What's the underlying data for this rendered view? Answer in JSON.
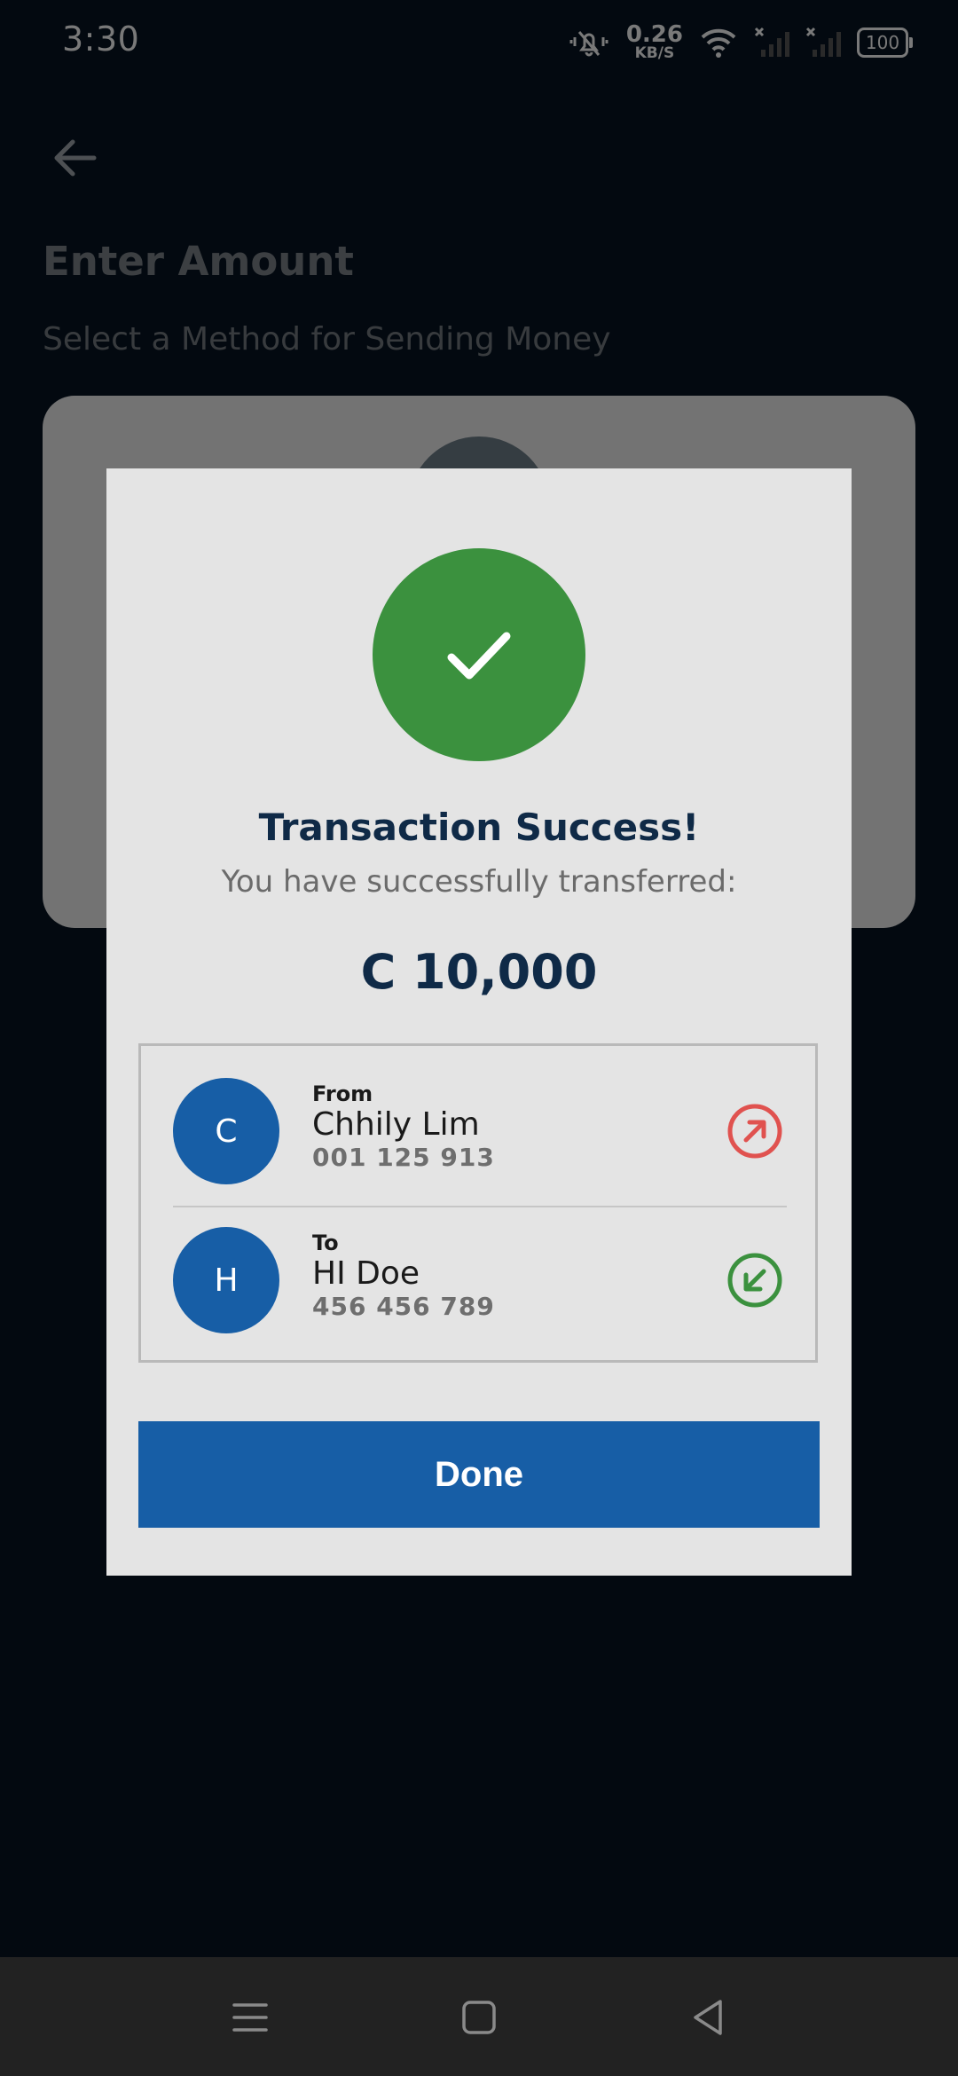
{
  "status_bar": {
    "time": "3:30",
    "net_speed_value": "0.26",
    "net_speed_unit": "KB/S",
    "battery": "100"
  },
  "page": {
    "title": "Enter Amount",
    "subtitle": "Select a Method for Sending Money"
  },
  "dialog": {
    "title": "Transaction Success!",
    "subtitle": "You have successfully transferred:",
    "amount": "C 10,000",
    "from": {
      "role": "From",
      "initial": "C",
      "name": "Chhily Lim",
      "account": "001 125 913",
      "icon": "outgoing-arrow-icon"
    },
    "to": {
      "role": "To",
      "initial": "H",
      "name": "HI Doe",
      "account": "456 456 789",
      "icon": "incoming-arrow-icon"
    },
    "done_label": "Done"
  },
  "colors": {
    "background": "#061320",
    "success": "#3b913e",
    "primary": "#175ea6",
    "outgoing": "#e0524f",
    "incoming": "#3b913e",
    "heading": "#0f2a47"
  }
}
